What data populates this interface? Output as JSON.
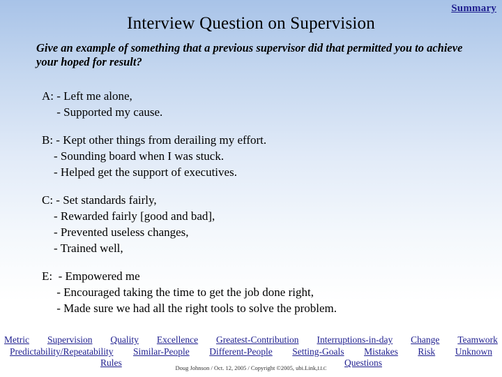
{
  "slide": {
    "summary_link": "Summary",
    "title": "Interview Question on Supervision",
    "question": "Give an example of something that a previous supervisor did that permitted you to achieve your hoped for result?",
    "answers": [
      {
        "label": "A",
        "lines": [
          "A: - Left me alone,",
          "     - Supported my cause."
        ]
      },
      {
        "label": "B",
        "lines": [
          "B: - Kept other things from derailing my effort.",
          "    - Sounding board when I was stuck.",
          "    - Helped get the support of executives."
        ]
      },
      {
        "label": "C",
        "lines": [
          "C: - Set standards fairly,",
          "    - Rewarded fairly [good and bad],",
          "    - Prevented useless changes,",
          "    - Trained well,"
        ]
      },
      {
        "label": "E",
        "lines": [
          "E:  - Empowered me",
          "     - Encouraged taking the time to get the job done right,",
          "     - Made sure we had all the right tools to solve the problem."
        ]
      }
    ],
    "nav_row1": [
      "Metric",
      "Supervision",
      "Quality",
      "Excellence",
      "Greatest-Contribution",
      "Interruptions-in-day",
      "Change",
      "Teamwork"
    ],
    "nav_row2": [
      "Predictability/Repeatability",
      "Similar-People",
      "Different-People",
      "Setting-Goals",
      "Mistakes",
      "Risk",
      "Unknown"
    ],
    "nav_rules": "Rules",
    "nav_questions": "Questions",
    "footer": "Doug Johnson / Oct. 12, 2005 / Copyright ©2005, ubi.Link, LLC",
    "footer_main": "Doug Johnson / Oct. 12, 2005 / Copyright ©2005, ubi.Link,",
    "footer_tiny": "LLC"
  }
}
